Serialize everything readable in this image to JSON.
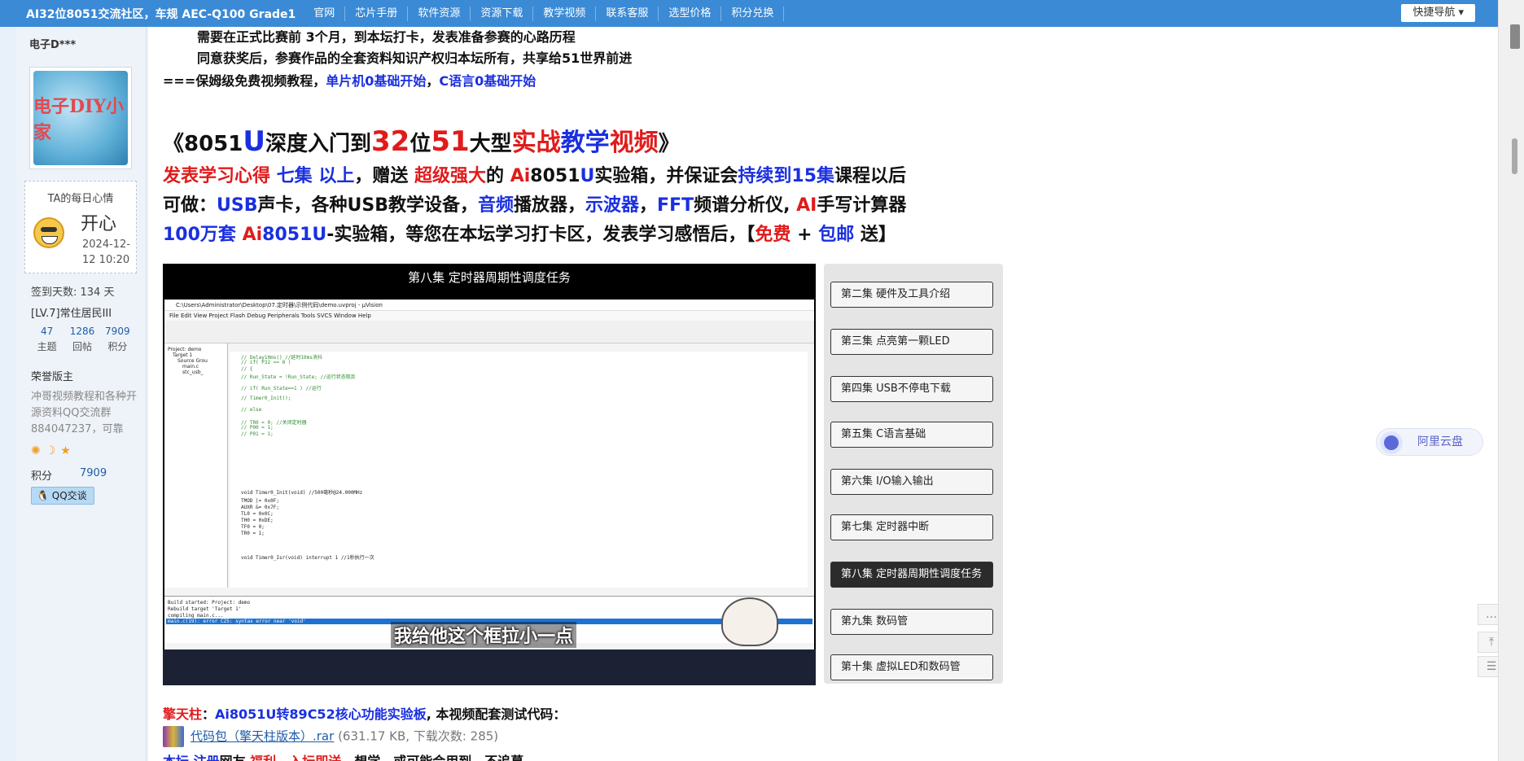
{
  "nav": {
    "brand": "AI32位8051交流社区，车规 AEC-Q100 Grade1",
    "items": [
      "官网",
      "芯片手册",
      "软件资源",
      "资源下载",
      "教学视频",
      "联系客服",
      "选型价格",
      "积分兑换"
    ],
    "quick_nav": "快捷导航"
  },
  "user": {
    "name": "电子D***",
    "avatar_text": "电子DIY小家",
    "mood_title": "TA的每日心情",
    "mood_word": "开心",
    "mood_date": "2024-12-12 10:20",
    "checkin": "签到天数: 134 天",
    "level": "[LV.7]常住居民III",
    "stats": [
      {
        "num": "47",
        "label": "主题"
      },
      {
        "num": "1286",
        "label": "回帖"
      },
      {
        "num": "7909",
        "label": "积分"
      }
    ],
    "role": "荣誉版主",
    "desc": "冲哥视频教程和各种开源资料QQ交流群884047237，可靠",
    "points_label": "积分",
    "points_value": "7909",
    "qq_button": "QQ交谈"
  },
  "post": {
    "line1": "需要在正式比赛前 3个月，到本坛打卡，发表准备参赛的心路历程",
    "line2": "同意获奖后，参赛作品的全套资料知识产权归本坛所有，共享给51世界前进",
    "line3_prefix": "===保姆级免费视频教程，",
    "line3_link1": "单片机0基础开始",
    "line3_sep": "，",
    "line3_link2": "C语言0基础开始",
    "title": {
      "p1": "《8051",
      "p2": "U",
      "p3": "深度入门到",
      "p4": "32",
      "p5": "位",
      "p6": "51",
      "p7": "大型",
      "p8": "实战",
      "p9": "教学",
      "p10": "视频",
      "p11": "》"
    },
    "body1": {
      "a": "发表学习心得",
      "b": " 七集 以上",
      "c": "，赠送 ",
      "d": "超级强大",
      "e": "的 ",
      "f": "Ai",
      "g": "8051",
      "h": "U",
      "i": "实验箱，并保证会",
      "j": "持续到15集",
      "k": "课程以后"
    },
    "body2": {
      "a": "可做：",
      "b": "USB",
      "c": "声卡，各种USB教学设备，",
      "d": "音频",
      "e": "播放器，",
      "f": "示波器",
      "g": "，",
      "h": "FFT",
      "i": "频谱分析仪, ",
      "j": "AI",
      "k": "手写计算器"
    },
    "body3": {
      "a": "100万套",
      "b": " Ai",
      "c": "8051U",
      "d": "-实验箱，等您在本坛学习打卡区，发表学习感悟后，【",
      "e": "免费",
      "f": " + ",
      "g": "包邮",
      "h": " 送】"
    }
  },
  "video": {
    "title": "第八集 定时器周期性调度任务",
    "window_title": "C:\\Users\\Administrator\\Desktop\\07.定时器\\示例代码\\demo.uvproj - µVision",
    "menu": "File  Edit  View  Project  Flash  Debug  Peripherals  Tools  SVCS  Window  Help",
    "tree": [
      "Project: demo",
      "Target 1",
      "Source Grou",
      "main.c",
      "stc_usb_"
    ],
    "code_lines": [
      "//          Delay10ms()                          //延时10ms消抖",
      "//          if( P32 == 0 )",
      "//          {",
      "//              Run_State = !Run_State;          //运行状态取反",
      "//              if( Run_State==1 )               //运行",
      "//                  Timer0_Init();",
      "//              else",
      "//                  TR0 = 0;                     //关闭定时器",
      "//                  P00 = 1;",
      "//                  P01 = 1;",
      "void Timer0_Init(void)        //500毫秒@24.000MHz",
      "    TMOD |= 0x0F;",
      "    AUXR &= 0x7F;",
      "    TL0 = 0x0C;",
      "    TH0 = 0xDE;",
      "    TF0 = 0;",
      "    TR0 = 1;",
      "void Timer0_Isr(void) interrupt 1      //1秒执行一次"
    ],
    "output_lines": [
      "Build started: Project: demo",
      "Rebuild target 'Target 1'",
      "compiling main.c...",
      "main.c(19): error C25: syntax error near 'void'"
    ],
    "subtitle": "我给他这个框拉小一点"
  },
  "playlist": [
    {
      "label": "第二集 硬件及工具介绍",
      "active": false
    },
    {
      "label": "第三集 点亮第一颗LED",
      "active": false
    },
    {
      "label": "第四集 USB不停电下载",
      "active": false
    },
    {
      "label": "第五集 C语言基础",
      "active": false
    },
    {
      "label": "第六集 I/O输入输出",
      "active": false
    },
    {
      "label": "第七集 定时器中断",
      "active": false
    },
    {
      "label": "第八集 定时器周期性调度任务",
      "active": true
    },
    {
      "label": "第九集 数码管",
      "active": false
    },
    {
      "label": "第十集 虚拟LED和数码管",
      "active": false
    }
  ],
  "attachment": {
    "label1": "擎天柱",
    "sep": "：",
    "label2": "Ai8051U转89C52核心功能实验板",
    "label3": ", 本视频配套测试代码：",
    "file": "代码包（擎天柱版本）.rar",
    "meta": " (631.17 KB, 下载次数: 285)",
    "footer_a": "本坛 ",
    "footer_b": "注册",
    "footer_c": "网友 ",
    "footer_d": "福利，",
    "footer_e": "入坛即送",
    "footer_f": "，想学，或可能会用到，不追募"
  },
  "cloud_label": "阿里云盘",
  "colors": {
    "nav": "#3a8ad6",
    "blue": "#1a2fe0",
    "red": "#e01b1b",
    "link": "#1e5ba8"
  }
}
